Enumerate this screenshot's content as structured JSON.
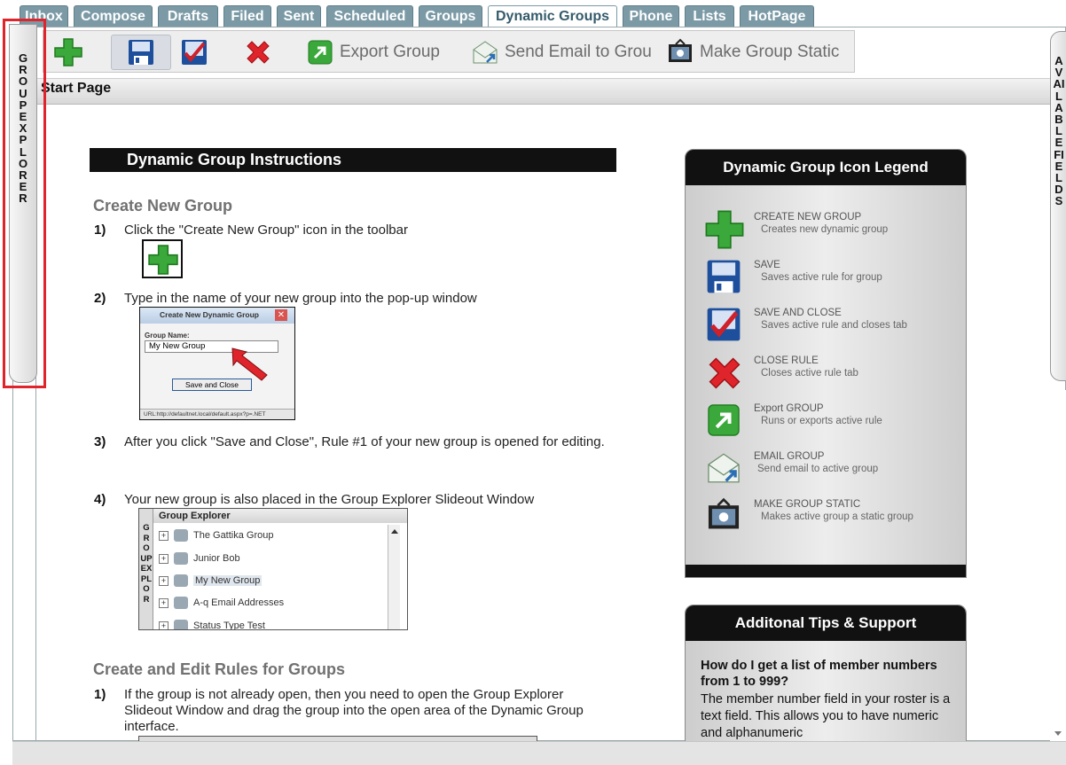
{
  "tabs": [
    {
      "label": "Inbox",
      "active": false
    },
    {
      "label": "Compose",
      "active": false
    },
    {
      "label": "Drafts",
      "active": false
    },
    {
      "label": "Filed",
      "active": false
    },
    {
      "label": "Sent",
      "active": false
    },
    {
      "label": "Scheduled",
      "active": false
    },
    {
      "label": "Groups",
      "active": false
    },
    {
      "label": "Dynamic Groups",
      "active": true
    },
    {
      "label": "Phone",
      "active": false
    },
    {
      "label": "Lists",
      "active": false
    },
    {
      "label": "HotPage",
      "active": false
    }
  ],
  "toolbar": {
    "export_label": "Export Group",
    "email_label": "Send Email to Grou",
    "static_label": "Make Group Static"
  },
  "side_tabs": {
    "left": "GROUPEXPLORER",
    "right": "AVAILABLEFIELDS"
  },
  "page": {
    "start_page": "Start Page"
  },
  "instructions": {
    "header": "Dynamic Group Instructions",
    "section1_title": "Create New Group",
    "steps": [
      {
        "num": "1)",
        "text": "Click the \"Create New Group\" icon in the toolbar"
      },
      {
        "num": "2)",
        "text": "Type in the name of your new group into the pop-up window"
      },
      {
        "num": "3)",
        "text": "After you click \"Save and Close\", Rule #1 of your new group is opened for editing."
      },
      {
        "num": "4)",
        "text": "Your new group is also placed in the Group Explorer Slideout Window"
      }
    ],
    "popup": {
      "title": "Create New Dynamic Group",
      "field_label": "Group Name:",
      "field_value": "My New Group",
      "button": "Save and Close",
      "status": "URL:http://defaultnet.local/default.aspx?p=.NET"
    },
    "explorer_shot": {
      "title": "Group Explorer",
      "side": "GROUPEXPLOR",
      "items": [
        "The Gattika Group",
        "Junior Bob",
        "My New Group",
        "A-q Email Addresses",
        "Status Type Test"
      ]
    },
    "section2_title": "Create and Edit Rules for Groups",
    "section2_steps": [
      {
        "num": "1)",
        "text": "If the group is not already open, then you need to open the Group Explorer Slideout Window and drag the group into the open area of the Dynamic Group interface."
      }
    ]
  },
  "legend": {
    "header": "Dynamic Group Icon Legend",
    "items": [
      {
        "icon": "plus-icon",
        "title": "CREATE NEW GROUP",
        "desc": "Creates new dynamic group"
      },
      {
        "icon": "save-icon",
        "title": "SAVE",
        "desc": "Saves active rule for group"
      },
      {
        "icon": "save-close-icon",
        "title": "SAVE AND CLOSE",
        "desc": "Saves active rule and closes tab"
      },
      {
        "icon": "close-icon",
        "title": "CLOSE RULE",
        "desc": "Closes active rule tab"
      },
      {
        "icon": "export-icon",
        "title": "Export GROUP",
        "desc": "Runs or exports active rule"
      },
      {
        "icon": "email-icon",
        "title": "EMAIL GROUP",
        "desc": "Send email to active group"
      },
      {
        "icon": "static-icon",
        "title": "MAKE GROUP STATIC",
        "desc": "Makes active group a static group"
      }
    ]
  },
  "tips": {
    "header": "Additonal Tips & Support",
    "question": "How do I get a list of member numbers from 1 to 999?",
    "answer": "The member number field in your roster is a text field. This allows you to have numeric and alphanumeric"
  },
  "colors": {
    "tab_bg": "#7b9aa6",
    "tab_active_text": "#345b6b",
    "highlight": "#e0242b",
    "green": "#3aa83a"
  }
}
